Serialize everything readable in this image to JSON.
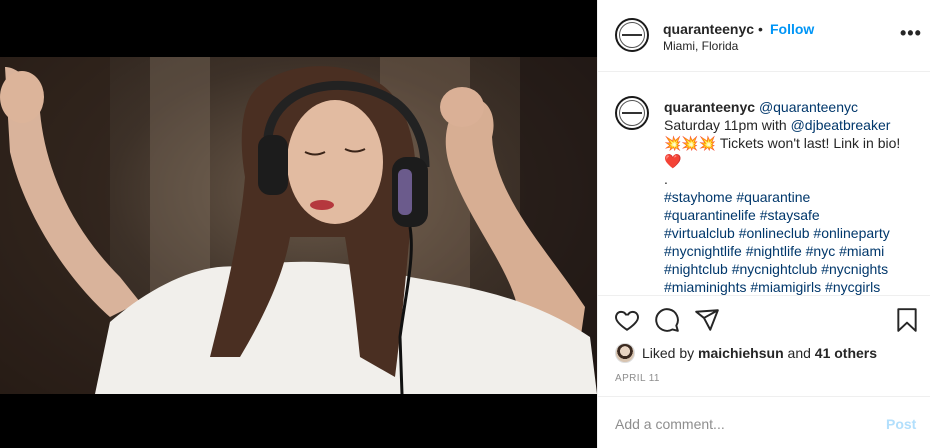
{
  "post": {
    "username": "quaranteenyc",
    "separator": "•",
    "follow_label": "Follow",
    "location": "Miami, Florida",
    "more_label": "•••"
  },
  "caption": {
    "username": "quaranteenyc",
    "handle": "@quaranteenyc",
    "line1_prefix": "Saturday 11pm with ",
    "mention": "@djbeatbreaker",
    "line2": "💥💥💥 Tickets won't last! Link in bio! ❤️",
    "dot": ".",
    "hashtags": [
      "#stayhome #quarantine",
      "#quarantinelife #staysafe",
      "#virtualclub #onlineclub #onlineparty",
      "#nycnightlife #nightlife #nyc #miami",
      "#nightclub #nycnightclub #nycnights",
      "#miaminights #miamigirls #nycgirls"
    ]
  },
  "likes": {
    "prefix": "Liked by",
    "user": "maichiehsun",
    "and": "and",
    "others": "41 others"
  },
  "date": "APRIL 11",
  "comment": {
    "placeholder": "Add a comment...",
    "post_label": "Post"
  },
  "icons": [
    "heart-icon",
    "comment-icon",
    "share-icon",
    "bookmark-icon",
    "more-icon"
  ]
}
